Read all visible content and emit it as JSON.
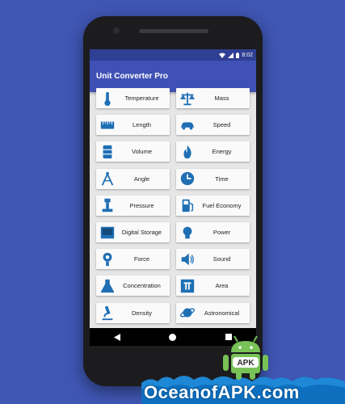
{
  "status_bar": {
    "time": "8:02"
  },
  "app_bar": {
    "title": "Unit Converter Pro"
  },
  "tiles": [
    {
      "label": "Temperature",
      "icon": "thermometer-icon"
    },
    {
      "label": "Mass",
      "icon": "scale-icon"
    },
    {
      "label": "Length",
      "icon": "ruler-icon"
    },
    {
      "label": "Speed",
      "icon": "car-icon"
    },
    {
      "label": "Volume",
      "icon": "barrel-icon"
    },
    {
      "label": "Energy",
      "icon": "flame-icon"
    },
    {
      "label": "Angle",
      "icon": "compass-icon"
    },
    {
      "label": "Time",
      "icon": "clock-icon"
    },
    {
      "label": "Pressure",
      "icon": "pressure-gauge-icon"
    },
    {
      "label": "Fuel Economy",
      "icon": "fuel-pump-icon"
    },
    {
      "label": "Digital Storage",
      "icon": "hard-drive-icon"
    },
    {
      "label": "Power",
      "icon": "light-bulb-icon"
    },
    {
      "label": "Force",
      "icon": "force-icon"
    },
    {
      "label": "Sound",
      "icon": "speaker-icon"
    },
    {
      "label": "Concentration",
      "icon": "flask-icon"
    },
    {
      "label": "Area",
      "icon": "pi-icon"
    },
    {
      "label": "Density",
      "icon": "microscope-icon"
    },
    {
      "label": "Astronomical",
      "icon": "planet-icon"
    }
  ],
  "watermark": {
    "text": "OceanofAPK.com",
    "badge": "APK"
  },
  "colors": {
    "background": "#3f56b3",
    "app_bar": "#3f51b5",
    "icon": "#1f6fb4"
  }
}
